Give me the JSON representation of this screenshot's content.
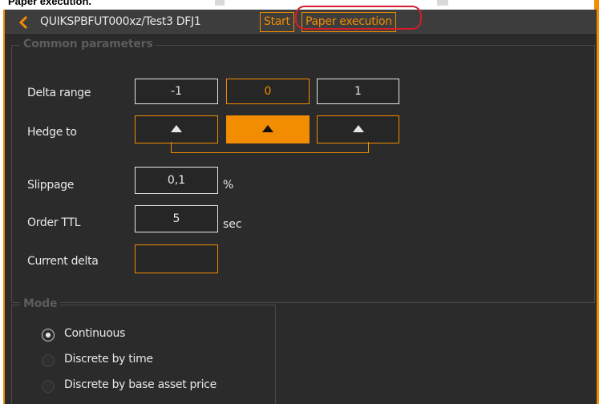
{
  "caption": "Paper execution.",
  "header": {
    "title": "QUIKSPBFUT000xz/Test3  DFJ1",
    "start_label": "Start",
    "paper_execution_label": "Paper execution"
  },
  "common": {
    "title": "Common parameters",
    "delta_range": {
      "label": "Delta range",
      "values": [
        "-1",
        "0",
        "1"
      ]
    },
    "hedge_to": {
      "label": "Hedge to"
    },
    "slippage": {
      "label": "Slippage",
      "value": "0,1",
      "unit": "%"
    },
    "order_ttl": {
      "label": "Order TTL",
      "value": "5",
      "unit": "sec"
    },
    "current_delta": {
      "label": "Current delta",
      "value": ""
    }
  },
  "mode": {
    "title": "Mode",
    "options": [
      "Continuous",
      "Discrete by time",
      "Discrete by base asset price"
    ],
    "selected": "Continuous"
  },
  "colors": {
    "accent": "#f28c00",
    "highlight": "#d41c2a",
    "panel": "#2b2b2b"
  }
}
